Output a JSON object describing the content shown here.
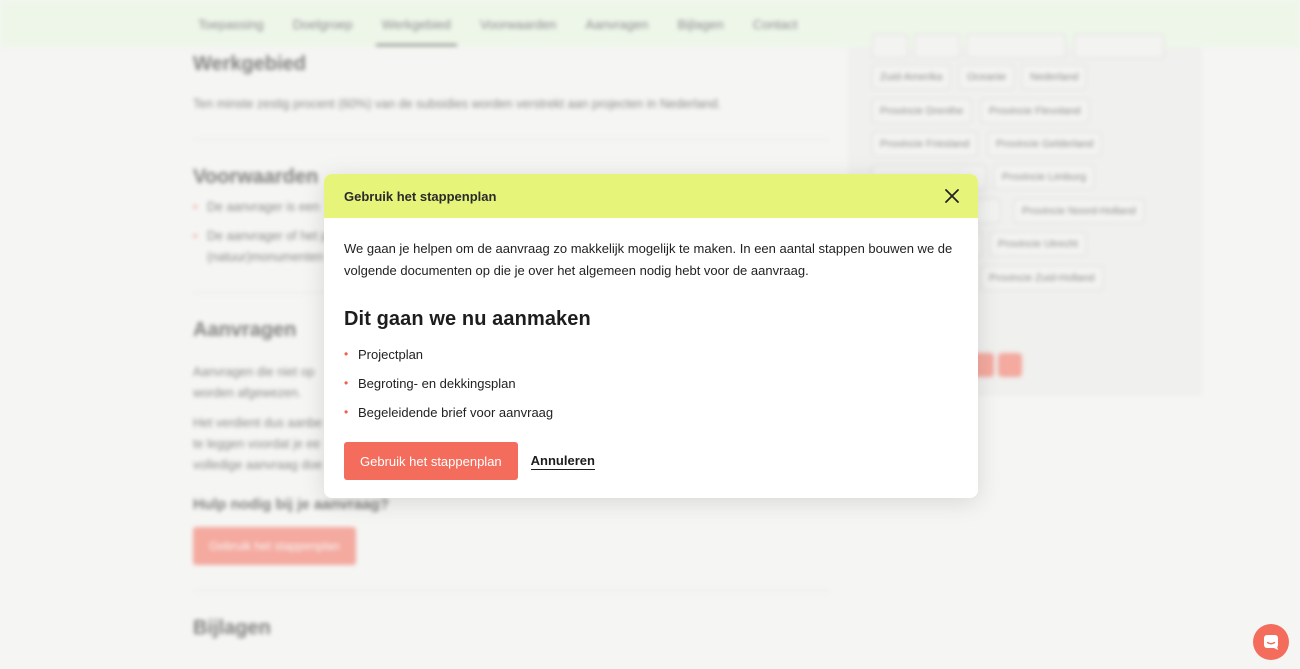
{
  "nav": {
    "items": [
      "Toepassing",
      "Doelgroep",
      "Werkgebied",
      "Voorwaarden",
      "Aanvragen",
      "Bijlagen",
      "Contact"
    ],
    "active": "Werkgebied"
  },
  "background": {
    "werkgebied_heading": "Werkgebied",
    "werkgebied_text": "Ten minste zestig procent (60%) van de subsidies worden verstrekt aan projecten in Nederland.",
    "voorwaarden_heading": "Voorwaarden",
    "voorwaarden_bullets": [
      "De aanvrager is een",
      "De aanvrager of het p"
    ],
    "voorwaarden_bullet2_line2": "(natuur)monumenten",
    "aanvragen_heading": "Aanvragen",
    "aanvragen_p1_l1": "Aanvragen die niet op",
    "aanvragen_p1_l2": "worden afgewezen.",
    "aanvragen_p2_l1": "Het verdient dus aanbe",
    "aanvragen_p2_l2": "te leggen voordat je ee",
    "aanvragen_p2_l3": "volledige aanvraag doe",
    "help_heading": "Hulp nodig bij je aanvraag?",
    "help_button": "Gebruik het stappenplan",
    "bijlagen_heading": "Bijlagen",
    "tags": [
      "Zuid-Amerika",
      "Oceanie",
      "Nederland",
      "Provincie Drenthe",
      "Provincie Flevoland",
      "Provincie Friesland",
      "Provincie Gelderland",
      "Provincie Limburg",
      "Provincie Noord-Holland",
      "Provincie Utrecht",
      "Provincie Zuid-Holland"
    ]
  },
  "modal": {
    "title": "Gebruik het stappenplan",
    "intro": "We gaan je helpen om de aanvraag zo makkelijk mogelijk te maken. In een aantal stappen bouwen we de volgende documenten op die je over het algemeen nodig hebt voor de aanvraag.",
    "heading": "Dit gaan we nu aanmaken",
    "documents": [
      "Projectplan",
      "Begroting- en dekkingsplan",
      "Begeleidende brief voor aanvraag"
    ],
    "primary_label": "Gebruik het stappenplan",
    "cancel_label": "Annuleren"
  },
  "colors": {
    "accent": "#f46d5c",
    "modal_header": "#e6f479",
    "nav_bg": "#e9f7e3"
  },
  "icons": {
    "close": "close-icon",
    "chat": "chat-icon"
  }
}
